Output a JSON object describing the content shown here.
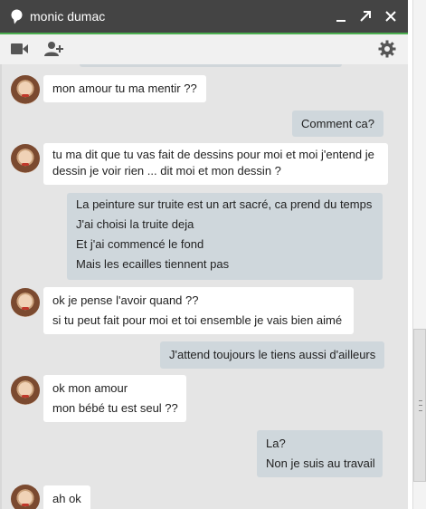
{
  "window": {
    "title": "monic dumac",
    "colors": {
      "titlebar": "#444444",
      "accent": "#4caf50",
      "incoming_bubble": "#ffffff",
      "outgoing_bubble": "#cfd7dc",
      "background": "#e5e5e5"
    },
    "icons": {
      "title": "speech-bubble-icon",
      "minimize": "minimize-icon",
      "popout": "popout-icon",
      "close": "close-icon",
      "video": "video-camera-icon",
      "add_person": "add-person-icon",
      "settings": "gear-icon"
    }
  },
  "messages": [
    {
      "direction": "in",
      "lines": [
        "mon amour tu ma mentir ??"
      ]
    },
    {
      "direction": "out",
      "lines": [
        "Comment ca?"
      ]
    },
    {
      "direction": "in",
      "lines": [
        "tu ma dit que tu vas fait de dessins  pour moi et moi j'entend je",
        "dessin je voir rien ... dit moi et mon dessin ?"
      ]
    },
    {
      "direction": "out",
      "lines": [
        "La peinture sur truite est un art sacré, ca prend du temps",
        "J'ai choisi la truite deja",
        "Et j'ai commencé le fond",
        "Mais les ecailles tiennent pas"
      ]
    },
    {
      "direction": "in",
      "lines": [
        "ok je pense l'avoir quand ??",
        "si tu peut fait pour moi et toi ensemble je vais bien aimé"
      ]
    },
    {
      "direction": "out",
      "lines": [
        "J'attend toujours le tiens aussi d'ailleurs"
      ]
    },
    {
      "direction": "in",
      "lines": [
        "ok mon amour",
        "mon bébé tu est seul ??"
      ]
    },
    {
      "direction": "out",
      "lines": [
        "La?",
        "Non je suis au travail"
      ]
    },
    {
      "direction": "in",
      "lines": [
        "ah ok"
      ]
    }
  ]
}
